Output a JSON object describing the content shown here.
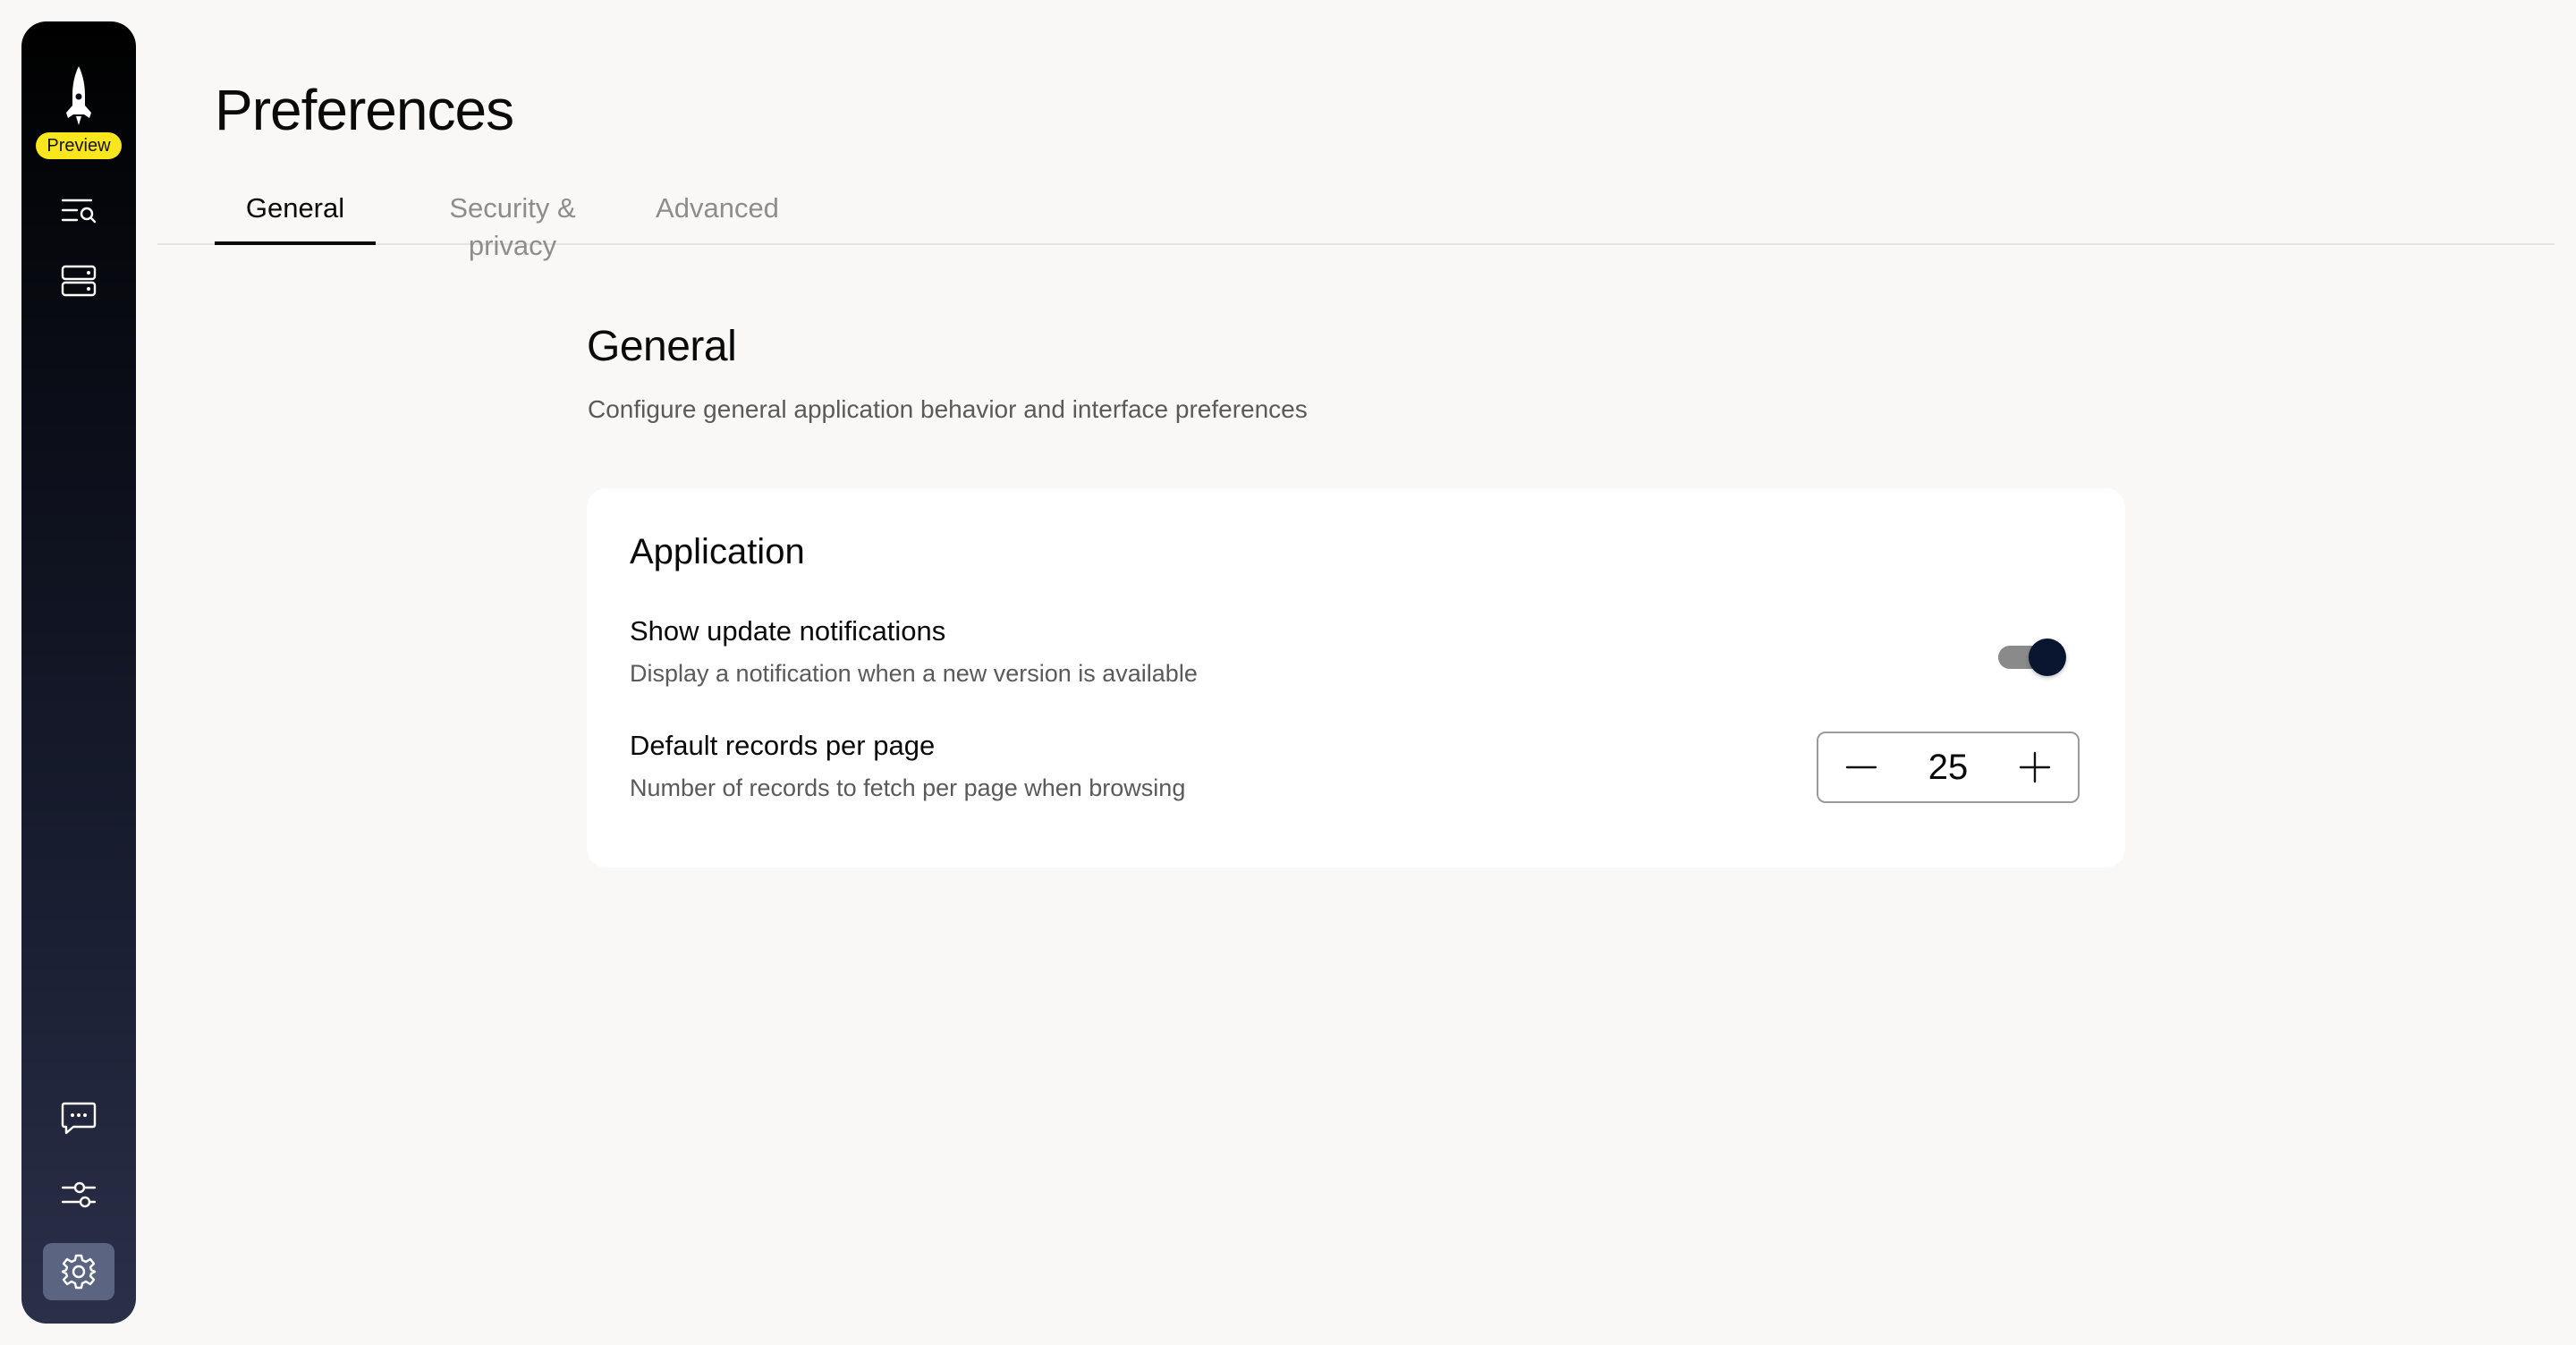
{
  "sidebar": {
    "badge": "Preview",
    "nav_icons": [
      "search-list-icon",
      "server-icon"
    ],
    "bottom_icons": [
      "chat-icon",
      "sliders-icon",
      "gear-icon"
    ],
    "active_item": "gear-icon"
  },
  "page": {
    "title": "Preferences"
  },
  "tabs": [
    {
      "label": "General",
      "active": true
    },
    {
      "label": "Security & privacy",
      "active": false
    },
    {
      "label": "Advanced",
      "active": false
    }
  ],
  "section": {
    "title": "General",
    "description": "Configure general application behavior and interface preferences"
  },
  "card": {
    "title": "Application",
    "settings": [
      {
        "label": "Show update notifications",
        "description": "Display a notification when a new version is available",
        "control": "toggle",
        "enabled": true
      },
      {
        "label": "Default records per page",
        "description": "Number of records to fetch per page when browsing",
        "control": "stepper",
        "value": "25"
      }
    ]
  },
  "colors": {
    "badge": "#fae61c",
    "toggle_thumb": "#0a1530",
    "toggle_track": "#8a8a8a",
    "active_sidebar_item": "#5b6480"
  }
}
